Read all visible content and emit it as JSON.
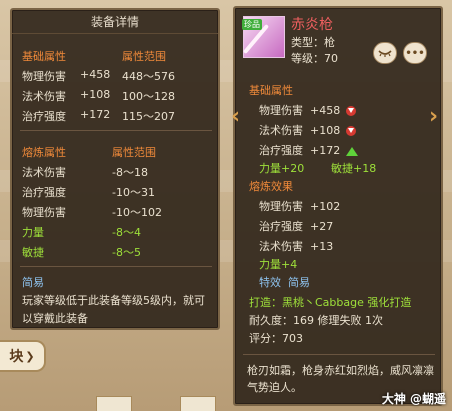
{
  "background": {
    "side_button_label": "块",
    "chevron": "❯"
  },
  "left_panel": {
    "title": "装备详情",
    "base_header": "基础属性",
    "range_header": "属性范围",
    "base_stats": [
      {
        "name": "物理伤害",
        "value": "+458",
        "range": "448～576"
      },
      {
        "name": "法术伤害",
        "value": "+108",
        "range": "100～128"
      },
      {
        "name": "治疗强度",
        "value": "+172",
        "range": "115～207"
      }
    ],
    "forge_header": "熔炼属性",
    "forge_range_header": "属性范围",
    "forge_stats": [
      {
        "name": "法术伤害",
        "range": "-8～18"
      },
      {
        "name": "治疗强度",
        "range": "-10～31"
      },
      {
        "name": "物理伤害",
        "range": "-10～102"
      }
    ],
    "green_stats": [
      {
        "name": "力量",
        "range": "-8～4"
      },
      {
        "name": "敏捷",
        "range": "-8～5"
      }
    ],
    "tag": "简易",
    "note": "玩家等级低于此装备等级5级内，就可以穿戴此装备"
  },
  "right_panel": {
    "item_name": "赤炎枪",
    "type_line": "类型：枪",
    "level_line": "等级：70",
    "badge": "珍品",
    "base_header": "基础属性",
    "base_stats": [
      {
        "name": "物理伤害",
        "value": "+458",
        "indicator": "down"
      },
      {
        "name": "法术伤害",
        "value": "+108",
        "indicator": "down"
      },
      {
        "name": "治疗强度",
        "value": "+172",
        "indicator": "up"
      }
    ],
    "green_line_a": "力量+20",
    "green_line_b": "敏捷+18",
    "forge_header": "熔炼效果",
    "forge_stats": [
      {
        "name": "物理伤害",
        "value": "+102"
      },
      {
        "name": "治疗强度",
        "value": "+27"
      },
      {
        "name": "法术伤害",
        "value": "+13"
      }
    ],
    "forge_green": "力量+4",
    "effect_label": "特效",
    "effect_value": "简易",
    "maker": "打造：黑桃丶Cabbage  强化打造",
    "durability": "耐久度：169 修理失败 1次",
    "score": "评分：703",
    "description": "枪刃如霜，枪身赤红如烈焰，威风凛凛气势迫人。",
    "more_label": "•••"
  },
  "watermark": "大神 @蝴遥"
}
